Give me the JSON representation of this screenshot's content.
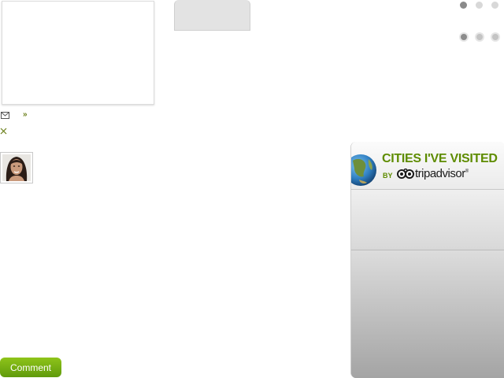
{
  "actions": {
    "comment_label": "Comment",
    "more_symbol": "»"
  },
  "widget": {
    "title": "CITIES I'VE VISITED",
    "by_label": "BY",
    "provider_name": "tripadvisor",
    "provider_mark": "®",
    "accent_color": "#5e8c00"
  },
  "pager": {
    "dots": [
      "active",
      "inactive",
      "inactive"
    ]
  },
  "icons": [
    "mail-icon",
    "more-icon",
    "close-icon",
    "avatar",
    "globe-icon",
    "tripadvisor-owl-icon"
  ]
}
